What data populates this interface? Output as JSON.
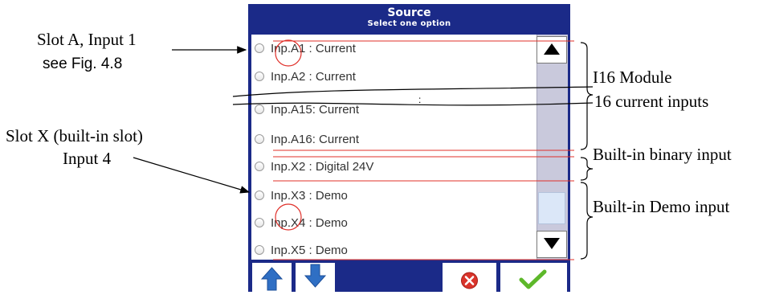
{
  "screen": {
    "title": "Source",
    "subtitle": "Select one option",
    "options": [
      {
        "label": "Inp.A1 : Current"
      },
      {
        "label": "Inp.A2 : Current"
      },
      {
        "label": "Inp.A15: Current"
      },
      {
        "label": "Inp.A16: Current"
      },
      {
        "label": "Inp.X2 : Digital 24V"
      },
      {
        "label": "Inp.X3 : Demo"
      },
      {
        "label": "Inp.X4 : Demo"
      },
      {
        "label": "Inp.X5 : Demo"
      }
    ],
    "buttons": {
      "up": "up-arrow-icon",
      "down": "down-arrow-icon",
      "cancel": "cancel-icon",
      "confirm": "checkmark-icon"
    }
  },
  "annotations": {
    "slot_a_line1": "Slot A, Input 1",
    "slot_a_line2": "see Fig. 4.8",
    "slot_x_line1": "Slot X (built-in slot)",
    "slot_x_line2": "Input 4",
    "i16_line1": "I16 Module",
    "i16_line2": "16 current inputs",
    "builtin_binary": "Built-in binary input",
    "builtin_demo": "Built-in Demo input"
  },
  "colors": {
    "panel": "#1b2a88",
    "highlight_circle": "#e0302a",
    "scroll_track": "#c9c9dc",
    "arrow_blue": "#2f6fc4",
    "cancel_red": "#d9342b",
    "confirm_green": "#5db82a"
  }
}
